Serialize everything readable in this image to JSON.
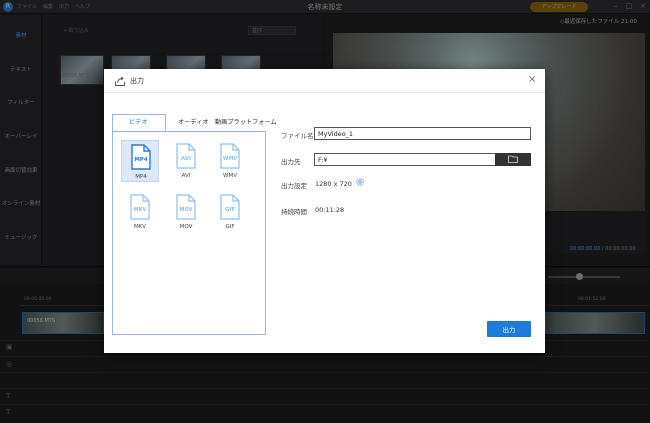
{
  "app": {
    "menu": [
      "ファイル",
      "編集",
      "出力",
      "ヘルプ"
    ],
    "window_title": "名称未設定",
    "upgrade_label": "アップグレード",
    "recent_label": "◇最近保存したファイル 21:00"
  },
  "sidebar": {
    "items": [
      {
        "label": "素材"
      },
      {
        "label": "テキスト"
      },
      {
        "label": "フィルター"
      },
      {
        "label": "オーバーレイ"
      },
      {
        "label": "画面切替効果"
      },
      {
        "label": "オンライン素材"
      },
      {
        "label": "ミュージック"
      }
    ]
  },
  "media": {
    "import_label": "+ 取り込み",
    "sort_label": "並び",
    "thumb_label": "00056.MTS"
  },
  "preview": {
    "time_current": "00:00:00.00",
    "time_total": "00:00:00.00"
  },
  "timeline": {
    "tc_start": "00:00:00:00",
    "tc_mid": "00:01:52:00",
    "clip_label": "00056.MTS"
  },
  "dialog": {
    "title": "出力",
    "close_label": "×",
    "tabs": [
      {
        "label": "ビデオ"
      },
      {
        "label": "オーディオ"
      },
      {
        "label": "動画プラットフォーム"
      }
    ],
    "formats": [
      {
        "name": "MP4",
        "badge": "MP4"
      },
      {
        "name": "AVI",
        "badge": "AVI"
      },
      {
        "name": "WMV",
        "badge": "WMV"
      },
      {
        "name": "MKV",
        "badge": "MKV"
      },
      {
        "name": "MOV",
        "badge": "MOV"
      },
      {
        "name": "GIF",
        "badge": "GIF"
      }
    ],
    "selected_format": "MP4",
    "fields": {
      "filename_label": "ファイル名",
      "filename_value": "MyVideo_1",
      "output_label": "出力先",
      "output_value": "F:¥",
      "settings_label": "出力設定",
      "settings_value": "1280 x 720",
      "duration_label": "持続時間",
      "duration_value": "00:11:28"
    },
    "export_label": "出力"
  },
  "colors": {
    "accent": "#1e7bdc",
    "selected_bg": "#dde8f5",
    "format_icon": "#5b9fe0"
  }
}
